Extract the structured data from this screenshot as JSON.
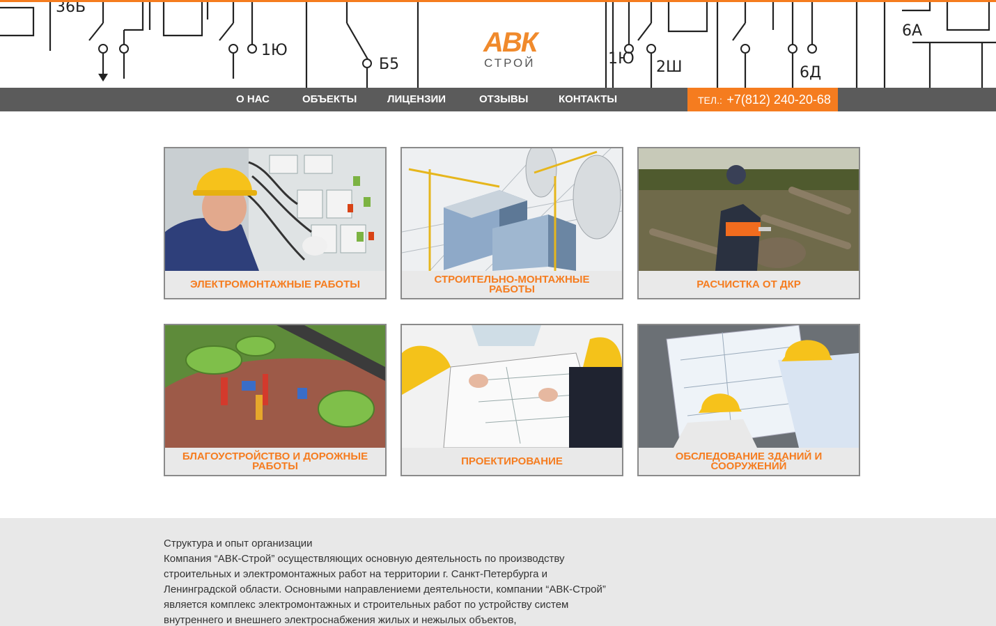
{
  "header": {
    "logo_mark": "АВК",
    "logo_sub": "СТРОЙ",
    "schematic_labels": [
      "36Б",
      "1Ю",
      "Б5",
      "1Ю",
      "2Ш",
      "6Д",
      "6А"
    ]
  },
  "nav": {
    "items": [
      {
        "label": "О НАС"
      },
      {
        "label": "ОБЪЕКТЫ"
      },
      {
        "label": "ЛИЦЕНЗИИ"
      },
      {
        "label": "ОТЗЫВЫ"
      },
      {
        "label": "КОНТАКТЫ"
      }
    ],
    "phone_label": "ТЕЛ.:",
    "phone_number": "+7(812) 240-20-68"
  },
  "services": [
    {
      "title": "ЭЛЕКТРОМОНТАЖНЫЕ РАБОТЫ",
      "image": "electrician-panel"
    },
    {
      "title": "СТРОИТЕЛЬНО-МОНТАЖНЫЕ РАБОТЫ",
      "image": "construction-cranes"
    },
    {
      "title": "РАСЧИСТКА ОТ ДКР",
      "image": "tree-clearing"
    },
    {
      "title": "БЛАГОУСТРОЙСТВО И ДОРОЖНЫЕ РАБОТЫ",
      "image": "park-playground"
    },
    {
      "title": "ПРОЕКТИРОВАНИЕ",
      "image": "engineers-blueprint"
    },
    {
      "title": "ОБСЛЕДОВАНИЕ ЗДАНИЙ И СООРУЖЕНИЙ",
      "image": "building-inspection"
    }
  ],
  "about": {
    "heading": "Структура и опыт организации",
    "body": "Компания “АВК-Строй” осуществляющих основную деятельность по производству строительных и электромонтажных работ на территории г. Санкт-Петербурга и Ленинградской области. Основными направлениеми деятельности, компании “АВК-Строй” является комплекс электромонтажных и строительных работ по устройству систем внутреннего и внешнего электроснабжения жилых и нежылых объектов,"
  },
  "colors": {
    "accent": "#f57c1f",
    "nav_bg": "#5b5b5b",
    "card_bg": "#e9e9e9",
    "about_bg": "#e8e8e8"
  }
}
